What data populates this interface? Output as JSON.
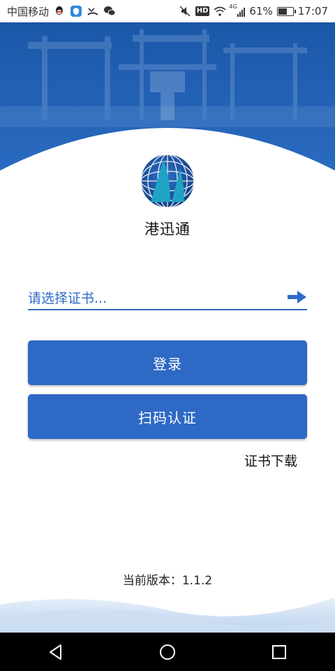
{
  "status_bar": {
    "carrier": "中国移动",
    "hd_label": "HD",
    "network_label": "4G",
    "battery_percent": "61%",
    "battery_level": 0.61,
    "time": "17:07",
    "left_icons": [
      "qq-icon",
      "shield-app-icon",
      "missed-call-icon",
      "wechat-icon"
    ],
    "right_icons": [
      "mute-icon",
      "hd-icon",
      "wifi-icon",
      "signal-icon",
      "battery-icon"
    ]
  },
  "header": {
    "background_color": "#1d5cad",
    "wave_color": "#ffffff"
  },
  "app": {
    "name": "港迅通",
    "logo": "sail-globe-logo"
  },
  "cert_select": {
    "placeholder": "请选择证书...",
    "icon": "arrow-right-icon",
    "accent": "#2e6bc8"
  },
  "buttons": {
    "login": "登录",
    "scan_auth": "扫码认证",
    "color": "#2e69c5"
  },
  "links": {
    "cert_download": "证书下载"
  },
  "footer": {
    "version": "当前版本：1.1.2"
  },
  "nav_bar": {
    "items": [
      "back-icon",
      "home-icon",
      "recents-icon"
    ]
  }
}
